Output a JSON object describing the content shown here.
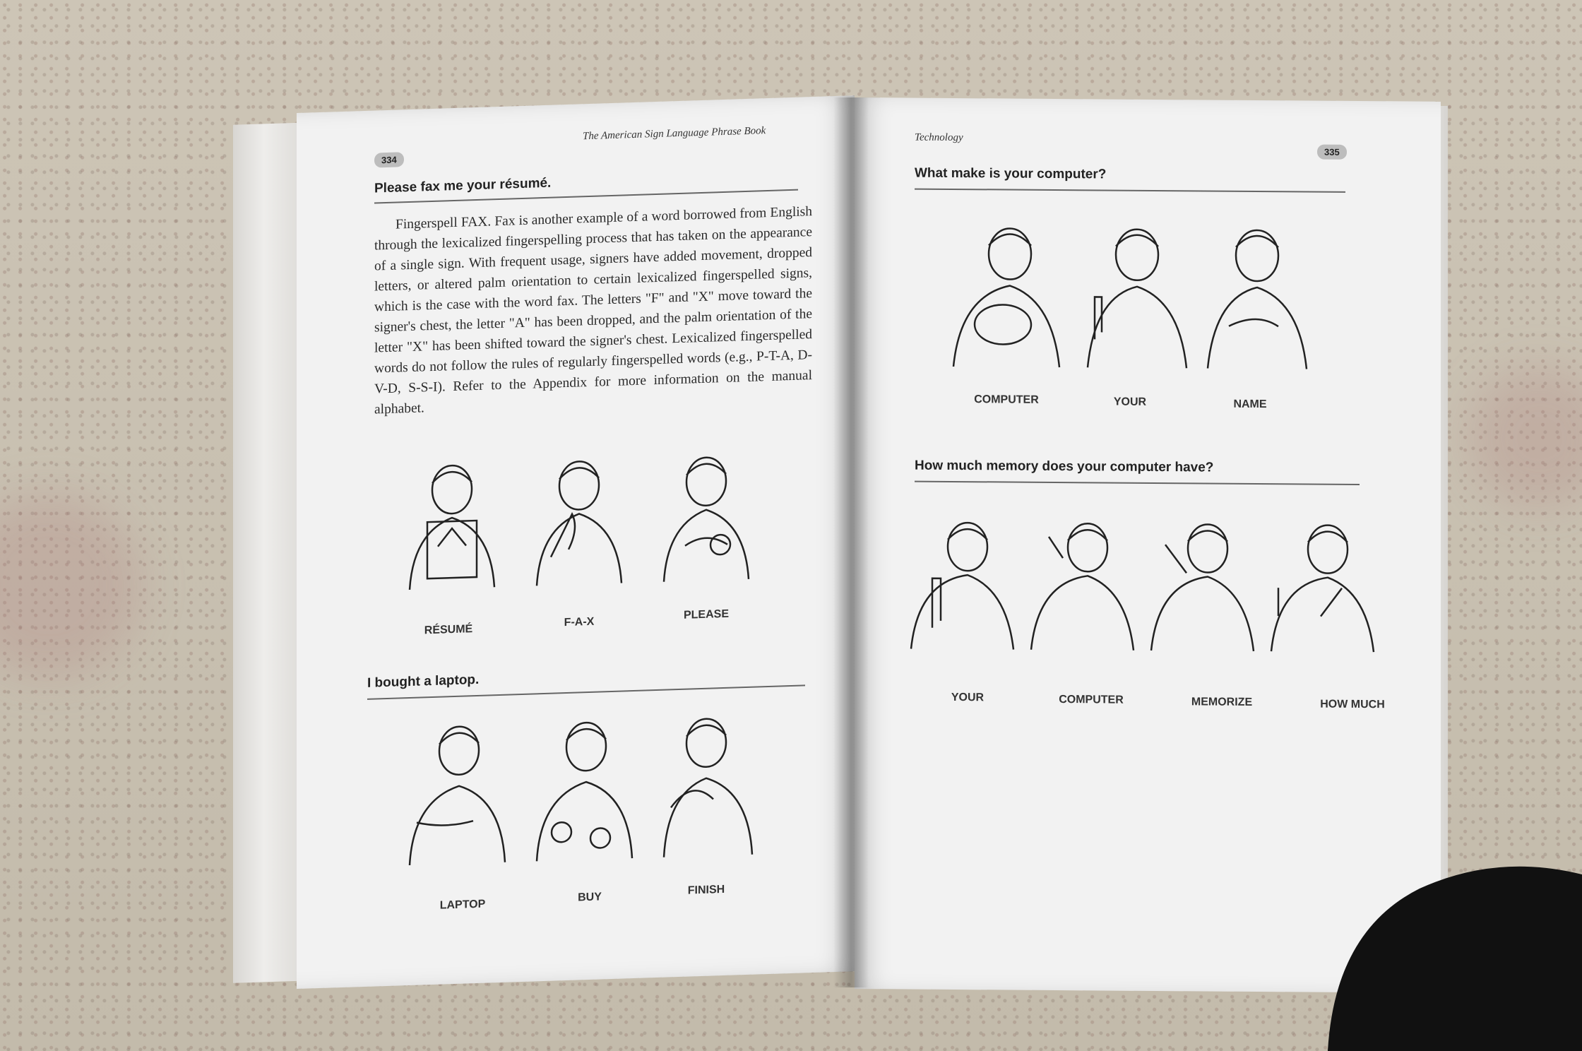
{
  "left_page": {
    "running_head": "The American Sign Language Phrase Book",
    "page_number": "334",
    "section1": {
      "heading": "Please fax me your résumé.",
      "body": "Fingerspell FAX. Fax is another example of a word borrowed from English through the lexicalized fingerspelling process that has taken on the appearance of a single sign. With frequent usage, signers have added movement, dropped letters, or altered palm orientation to certain lexicalized fingerspelled signs, which is the case with the word fax. The letters \"F\" and \"X\" move toward the signer's chest, the letter \"A\" has been dropped, and the palm orientation of the letter \"X\" has been shifted toward the signer's chest. Lexicalized fingerspelled words do not follow the rules of regularly fingerspelled words (e.g., P-T-A, D-V-D, S-S-I). Refer to the Appendix for more information on the manual alphabet.",
      "signs": [
        "RÉSUMÉ",
        "F-A-X",
        "PLEASE"
      ]
    },
    "section2": {
      "heading": "I bought a laptop.",
      "signs": [
        "LAPTOP",
        "BUY",
        "FINISH"
      ]
    }
  },
  "right_page": {
    "running_head": "Technology",
    "page_number": "335",
    "section1": {
      "heading": "What make is your computer?",
      "signs": [
        "COMPUTER",
        "YOUR",
        "NAME"
      ]
    },
    "section2": {
      "heading": "How much memory does your computer have?",
      "signs": [
        "YOUR",
        "COMPUTER",
        "MEMORIZE",
        "HOW MUCH"
      ]
    }
  },
  "colors": {
    "carpet": "#cbc3b4",
    "paper": "#f2f2f2",
    "ink": "#222222",
    "sock": "#111111"
  }
}
